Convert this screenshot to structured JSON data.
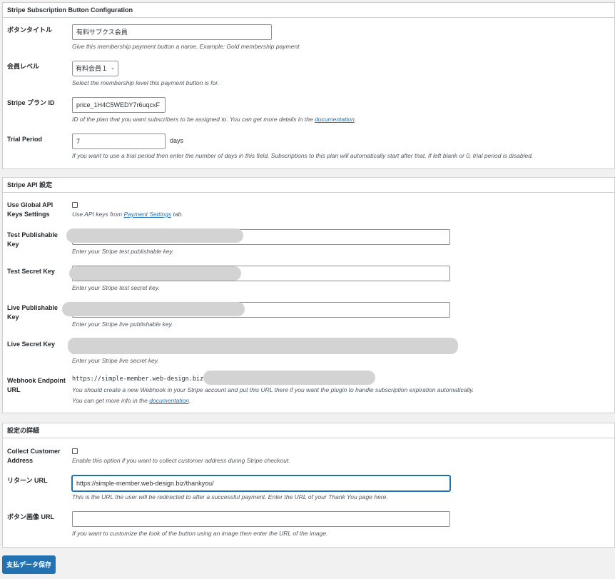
{
  "section1": {
    "title": "Stripe Subscription Button Configuration",
    "button_title": {
      "label": "ボタンタイトル",
      "value": "有料サブクス会員",
      "desc": "Give this membership payment button a name. Example: Gold membership payment"
    },
    "membership_level": {
      "label": "会員レベル",
      "value": "有料会員１",
      "desc": "Select the membership level this payment button is for."
    },
    "plan_id": {
      "label": "Stripe プラン ID",
      "value": "price_1H4C5WEDY7r6uqcxF",
      "desc": "ID of the plan that you want subscribers to be assigned to. You can get more details in the",
      "link": "documentation",
      "desc_end": "."
    },
    "trial_period": {
      "label": "Trial Period",
      "value": "7",
      "suffix": "days",
      "desc": "If you want to use a trial period then enter the number of days in this field. Subscriptions to this plan will automatically start after that. If left blank or 0, trial period is disabled."
    }
  },
  "section2": {
    "title": "Stripe API 設定",
    "global_keys": {
      "label": "Use Global API Keys Settings",
      "desc_pre": "Use API keys from",
      "link": "Payment Settings",
      "desc_post": "tab."
    },
    "test_pub": {
      "label": "Test Publishable Key",
      "desc": "Enter your Stripe test publishable key."
    },
    "test_secret": {
      "label": "Test Secret Key",
      "desc": "Enter your Stripe test secret key."
    },
    "live_pub": {
      "label": "Live Publishable Key",
      "desc": "Enter your Stripe live publishable key."
    },
    "live_secret": {
      "label": "Live Secret Key",
      "desc": "Enter your Stripe live secret key."
    },
    "webhook": {
      "label": "Webhook Endpoint URL",
      "value": "https://simple-member.web-design.biz",
      "desc1": "You should create a new Webhook in your Stripe account and put this URL there if you want the plugin to handle subscription expiration automatically.",
      "desc2_pre": "You can get more info in the",
      "link": "documentation",
      "desc2_post": "."
    }
  },
  "section3": {
    "title": "設定の詳細",
    "collect_address": {
      "label": "Collect Customer Address",
      "desc": "Enable this option if you want to collect customer address during Stripe checkout."
    },
    "return_url": {
      "label": "リターン URL",
      "value": "https://simple-member.web-design.biz/thankyou/",
      "desc": "This is the URL the user will be redirected to after a successful payment. Enter the URL of your Thank You page here."
    },
    "button_image": {
      "label": "ボタン画像 URL",
      "value": "",
      "desc": "If you want to customize the look of the button using an image then enter the URL of the image."
    }
  },
  "save_button": "支払データ保存"
}
